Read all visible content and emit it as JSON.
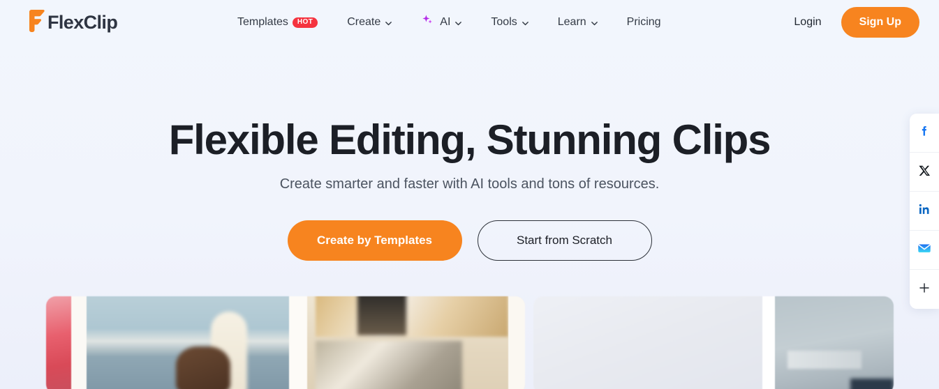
{
  "brand": {
    "name": "FlexClip",
    "logo_icon": "flexclip-f-mark",
    "accent_orange": "#f7841f",
    "logo_text_color": "#2f3542"
  },
  "header": {
    "nav_items": [
      {
        "label": "Templates",
        "badge": "HOT",
        "has_caret": false,
        "icon": null
      },
      {
        "label": "Create",
        "badge": null,
        "has_caret": true,
        "icon": null
      },
      {
        "label": "AI",
        "badge": null,
        "has_caret": true,
        "icon": "sparkle-icon"
      },
      {
        "label": "Tools",
        "badge": null,
        "has_caret": true,
        "icon": null
      },
      {
        "label": "Learn",
        "badge": null,
        "has_caret": true,
        "icon": null
      },
      {
        "label": "Pricing",
        "badge": null,
        "has_caret": false,
        "icon": null
      }
    ],
    "login_label": "Login",
    "signup_label": "Sign Up",
    "badge_color": "#f5333f",
    "sparkle_color": "#b429e8"
  },
  "hero": {
    "title": "Flexible Editing, Stunning Clips",
    "subtitle": "Create smarter and faster with AI tools and tons of resources.",
    "primary_cta": "Create by Templates",
    "secondary_cta": "Start from Scratch"
  },
  "social_rail": {
    "items": [
      {
        "name": "facebook",
        "icon": "facebook-icon",
        "color": "#1877f2"
      },
      {
        "name": "x-twitter",
        "icon": "x-icon",
        "color": "#000000"
      },
      {
        "name": "linkedin",
        "icon": "linkedin-icon",
        "color": "#0a66c2"
      },
      {
        "name": "email",
        "icon": "email-icon",
        "color": "#2f9cf4"
      },
      {
        "name": "more",
        "icon": "plus-icon",
        "color": "#222831"
      }
    ]
  },
  "carousel": {
    "cards": [
      {
        "name": "template-card-beach-collage",
        "alt": "blurred beach surfer and sepia polaroid collage"
      },
      {
        "name": "template-card-interior",
        "alt": "blurred light panel and interior photo"
      }
    ]
  }
}
